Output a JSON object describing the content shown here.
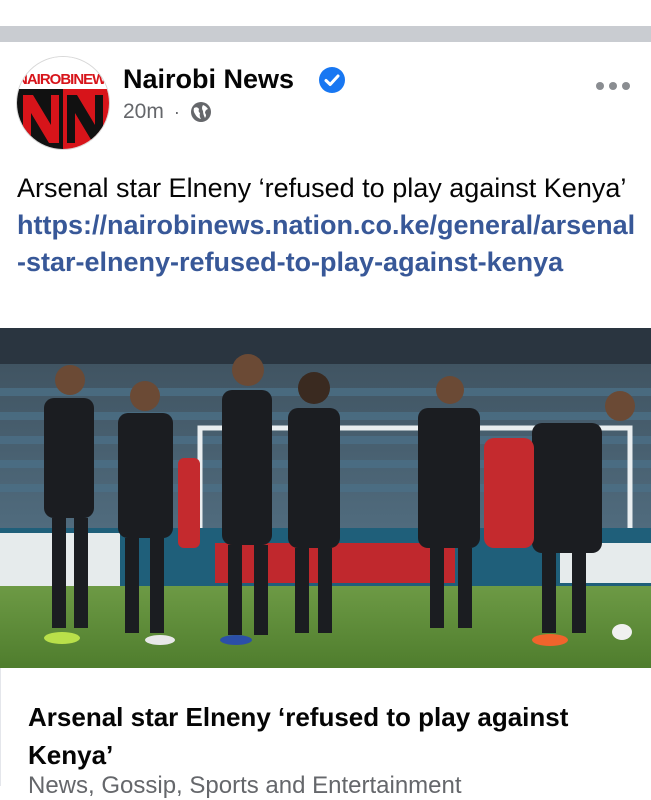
{
  "post": {
    "page_name": "Nairobi News",
    "avatar_text": "NAIROBINEWS",
    "time": "20m",
    "separator": "·",
    "text_before_link": "Arsenal star Elneny ‘refused to play against Kenya’ ",
    "link": "https://nairobinews.nation.co.ke/general/arsenal-star-elneny-refused-to-play-against-kenya"
  },
  "link_preview": {
    "title": "Arsenal star Elneny ‘refused to play against Kenya’",
    "subtitle": "News, Gossip, Sports and Entertainment"
  },
  "icons": {
    "verified": "verified-badge-icon",
    "audience": "globe-icon",
    "more": "more-options-icon"
  },
  "colors": {
    "link": "#385898",
    "verified": "#1877f2",
    "brand_red": "#d7141a",
    "separator": "#c9ccd1"
  }
}
